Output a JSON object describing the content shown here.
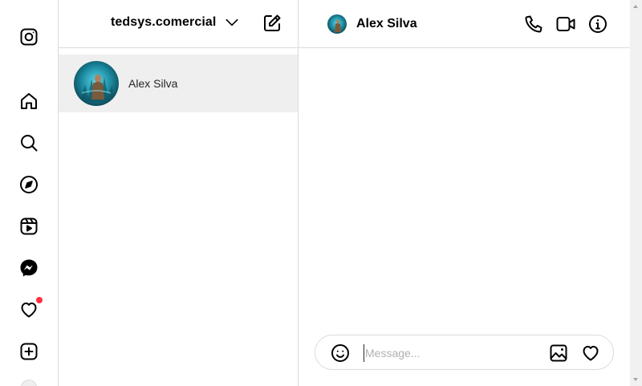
{
  "nav": {
    "items": [
      {
        "name": "instagram-logo-icon"
      },
      {
        "name": "home-icon"
      },
      {
        "name": "search-icon"
      },
      {
        "name": "explore-compass-icon"
      },
      {
        "name": "reels-icon"
      },
      {
        "name": "messenger-icon"
      },
      {
        "name": "notifications-heart-icon",
        "has_badge": true
      },
      {
        "name": "create-plus-icon"
      },
      {
        "name": "profile-avatar"
      }
    ],
    "badge_color": "#ff3040"
  },
  "inbox": {
    "account_name": "tedsys.comercial",
    "threads": [
      {
        "name": "Alex Silva",
        "selected": true
      }
    ]
  },
  "chat": {
    "peer_name": "Alex Silva",
    "header_actions": [
      "phone-icon",
      "video-call-icon",
      "info-icon"
    ],
    "composer": {
      "placeholder": "Message...",
      "value": ""
    }
  },
  "colors": {
    "border": "#dbdbdb",
    "selected_thread_bg": "#efefef",
    "text": "#000000"
  }
}
